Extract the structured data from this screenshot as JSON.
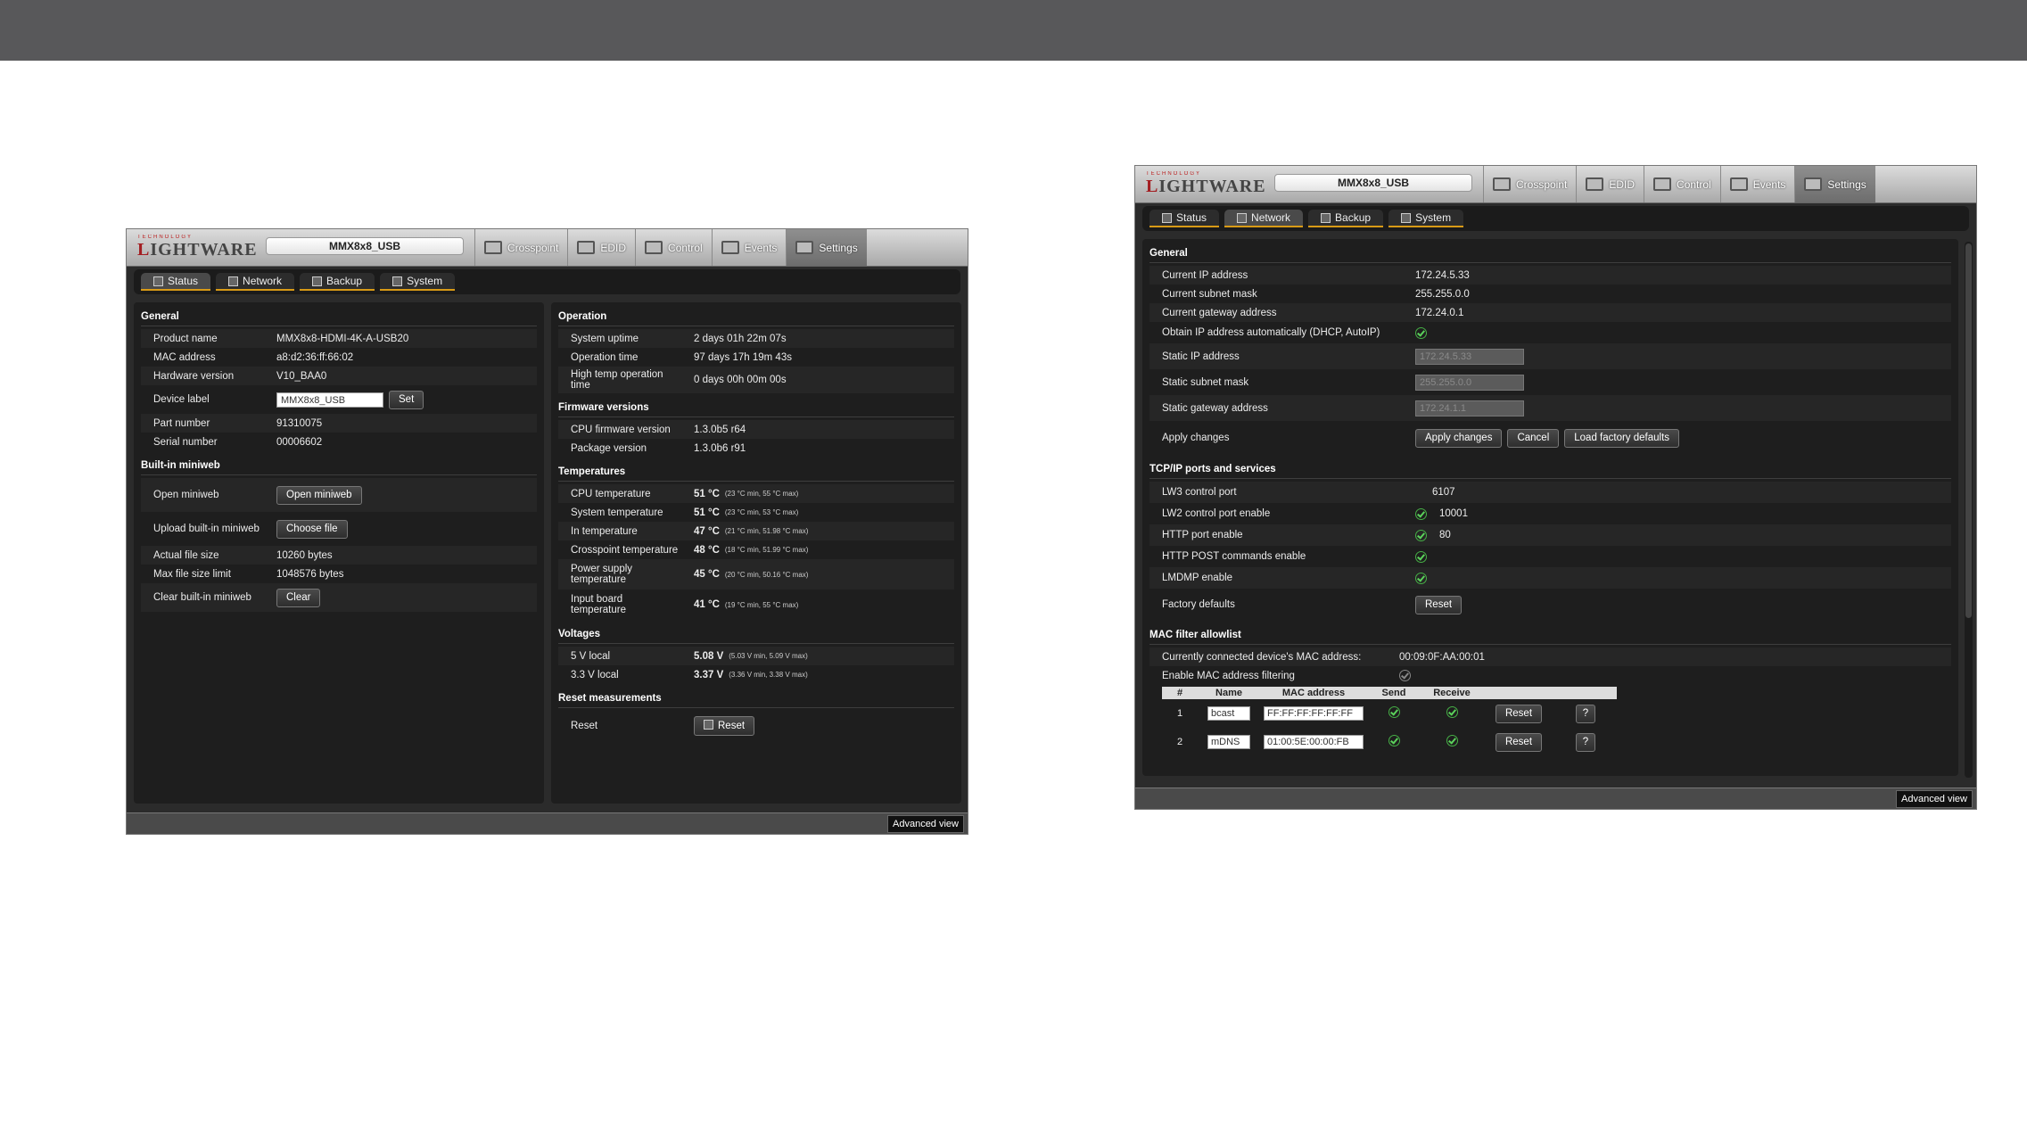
{
  "screenshot1": {
    "logo_tag": "TECHNOLOGY",
    "logo": "LIGHTWARE",
    "device": "MMX8x8_USB",
    "tabs": [
      "Crosspoint",
      "EDID",
      "Control",
      "Events",
      "Settings"
    ],
    "subtabs": [
      "Status",
      "Network",
      "Backup",
      "System"
    ],
    "general": {
      "title": "General",
      "rows": [
        [
          "Product name",
          "MMX8x8-HDMI-4K-A-USB20"
        ],
        [
          "MAC address",
          "a8:d2:36:ff:66:02"
        ],
        [
          "Hardware version",
          "V10_BAA0"
        ]
      ],
      "device_label_k": "Device label",
      "device_label_v": "MMX8x8_USB",
      "set": "Set",
      "rows2": [
        [
          "Part number",
          "91310075"
        ],
        [
          "Serial number",
          "00006602"
        ]
      ]
    },
    "miniweb": {
      "title": "Built-in miniweb",
      "open_k": "Open miniweb",
      "open_b": "Open miniweb",
      "upload_k": "Upload built-in miniweb",
      "upload_b": "Choose file",
      "rows": [
        [
          "Actual file size",
          "10260 bytes"
        ],
        [
          "Max file size limit",
          "1048576 bytes"
        ]
      ],
      "clear_k": "Clear built-in miniweb",
      "clear_b": "Clear"
    },
    "operation": {
      "title": "Operation",
      "rows": [
        [
          "System uptime",
          "2 days 01h 22m 07s"
        ],
        [
          "Operation time",
          "97 days 17h 19m 43s"
        ],
        [
          "High temp operation time",
          "0 days 00h 00m 00s"
        ]
      ]
    },
    "firmware": {
      "title": "Firmware versions",
      "rows": [
        [
          "CPU firmware version",
          "1.3.0b5 r64"
        ],
        [
          "Package version",
          "1.3.0b6 r91"
        ]
      ]
    },
    "temps": {
      "title": "Temperatures",
      "rows": [
        [
          "CPU temperature",
          "51 °C",
          "(23 °C min, 55 °C max)"
        ],
        [
          "System temperature",
          "51 °C",
          "(23 °C min, 53 °C max)"
        ],
        [
          "In temperature",
          "47 °C",
          "(21 °C min, 51.98 °C max)"
        ],
        [
          "Crosspoint temperature",
          "48 °C",
          "(18 °C min, 51.99 °C max)"
        ],
        [
          "Power supply temperature",
          "45 °C",
          "(20 °C min, 50.16 °C max)"
        ],
        [
          "Input board temperature",
          "41 °C",
          "(19 °C min, 55 °C max)"
        ]
      ]
    },
    "volts": {
      "title": "Voltages",
      "rows": [
        [
          "5 V local",
          "5.08 V",
          "(5.03 V min, 5.09 V max)"
        ],
        [
          "3.3 V local",
          "3.37 V",
          "(3.36 V min, 3.38 V max)"
        ]
      ]
    },
    "reset": {
      "title": "Reset measurements",
      "k": "Reset",
      "b": "Reset"
    },
    "advanced": "Advanced view"
  },
  "screenshot2": {
    "logo_tag": "TECHNOLOGY",
    "logo": "LIGHTWARE",
    "device": "MMX8x8_USB",
    "tabs": [
      "Crosspoint",
      "EDID",
      "Control",
      "Events",
      "Settings"
    ],
    "subtabs": [
      "Status",
      "Network",
      "Backup",
      "System"
    ],
    "general": {
      "title": "General",
      "rows": [
        [
          "Current IP address",
          "172.24.5.33"
        ],
        [
          "Current subnet mask",
          "255.255.0.0"
        ],
        [
          "Current gateway address",
          "172.24.0.1"
        ]
      ],
      "dhcp": "Obtain IP address automatically (DHCP, AutoIP)",
      "static": [
        [
          "Static IP address",
          "172.24.5.33"
        ],
        [
          "Static subnet mask",
          "255.255.0.0"
        ],
        [
          "Static gateway address",
          "172.24.1.1"
        ]
      ],
      "apply_k": "Apply changes",
      "apply_b": "Apply changes",
      "cancel_b": "Cancel",
      "factory_b": "Load factory defaults"
    },
    "tcp": {
      "title": "TCP/IP ports and services",
      "lw3_k": "LW3 control port",
      "lw3_v": "6107",
      "lw2_k": "LW2 control port enable",
      "lw2_v": "10001",
      "http_k": "HTTP port enable",
      "http_v": "80",
      "post_k": "HTTP POST commands enable",
      "lmdmp_k": "LMDMP enable",
      "fd_k": "Factory defaults",
      "fd_b": "Reset"
    },
    "mac": {
      "title": "MAC filter allowlist",
      "cur_k": "Currently connected device's MAC address:",
      "cur_v": "00:09:0F:AA:00:01",
      "en_k": "Enable MAC address filtering",
      "cols": [
        "#",
        "Name",
        "MAC address",
        "Send",
        "Receive"
      ],
      "rows": [
        [
          "1",
          "bcast",
          "FF:FF:FF:FF:FF:FF"
        ],
        [
          "2",
          "mDNS",
          "01:00:5E:00:00:FB"
        ]
      ],
      "reset": "Reset",
      "help": "?"
    },
    "advanced": "Advanced view"
  }
}
